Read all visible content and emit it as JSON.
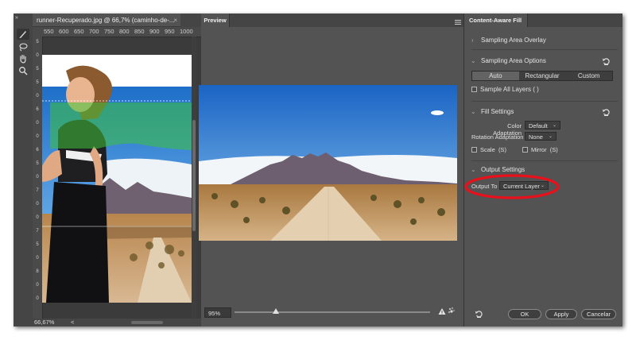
{
  "document": {
    "tab_title": "runner-Recuperado.jpg @ 66,7% (caminho-de-...",
    "close_label": "×",
    "ruler_top": [
      "550",
      "600",
      "650",
      "700",
      "750",
      "800",
      "850",
      "900",
      "950",
      "1000"
    ],
    "ruler_left": [
      "5",
      "0",
      "5",
      "5",
      "0",
      "6",
      "0",
      "0",
      "6",
      "5",
      "0",
      "7",
      "0",
      "0",
      "7",
      "5",
      "0",
      "8",
      "0",
      "0"
    ],
    "zoom_status": "66,67%",
    "scroll_arrow": "<"
  },
  "toolbar": {
    "collapse": "»",
    "tools": [
      {
        "name": "brush-icon"
      },
      {
        "name": "lasso-icon"
      },
      {
        "name": "hand-icon"
      },
      {
        "name": "zoom-icon"
      }
    ]
  },
  "preview": {
    "tab_label": "Preview",
    "zoom_value": "95%",
    "zoom_fraction": 0.21
  },
  "panel": {
    "tab_label": "Content-Aware Fill",
    "sampling_overlay": "Sampling Area Overlay",
    "sampling_options": "Sampling Area Options",
    "segments": [
      "Auto",
      "Rectangular",
      "Custom"
    ],
    "segment_selected": "Auto",
    "sample_all_layers": "Sample All Layers",
    "sample_all_layers_key": "( )",
    "fill_settings": "Fill Settings",
    "color_adaptation_label": "Color Adaptation",
    "color_adaptation_value": "Default",
    "rotation_adaptation_label": "Rotation Adaptation",
    "rotation_adaptation_value": "None",
    "scale_label": "Scale",
    "scale_key": "(S)",
    "mirror_label": "Mirror",
    "mirror_key": "(S)",
    "output_settings": "Output Settings",
    "output_to_label": "Output To",
    "output_to_value": "Current Layer",
    "ok_label": "OK",
    "apply_label": "Apply",
    "cancel_label": "Cancelar",
    "highlight_color": "#e8101a"
  }
}
